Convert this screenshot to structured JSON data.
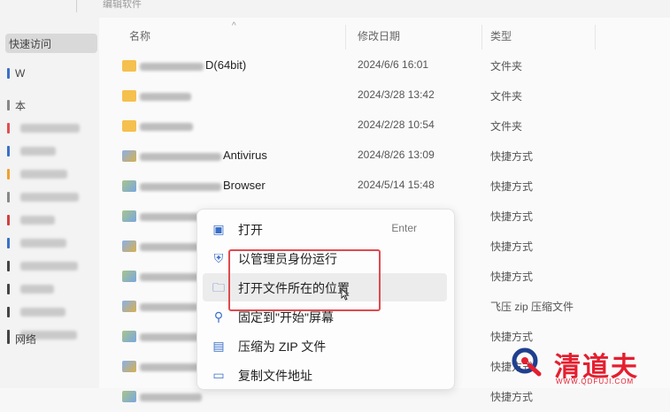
{
  "breadcrumb": "编辑软件",
  "sidebar": {
    "items": [
      {
        "label": "快速访问",
        "selected": true
      },
      {
        "label": "W",
        "color": "#3a6fc8"
      },
      {
        "label": "本",
        "color": "#888888"
      },
      {
        "label": "",
        "color": "#e05050"
      },
      {
        "label": "",
        "color": "#3a6fc8"
      },
      {
        "label": "",
        "color": "#f0a030"
      },
      {
        "label": "",
        "color": "#888888"
      },
      {
        "label": "",
        "color": "#d04040"
      },
      {
        "label": "",
        "color": "#3a6fc8"
      },
      {
        "label": "",
        "color": "#444444"
      },
      {
        "label": "",
        "color": "#444444"
      },
      {
        "label": "",
        "color": "#444444"
      },
      {
        "label": "",
        "color": "#444444"
      },
      {
        "label": "网络",
        "color": "#444444"
      }
    ]
  },
  "columns": {
    "name": "名称",
    "sort_icon": "^",
    "date": "修改日期",
    "type": "类型"
  },
  "rows": [
    {
      "icon": "folder",
      "name": "D(64bit)",
      "date": "2024/6/6 16:01",
      "type": "文件夹"
    },
    {
      "icon": "folder",
      "name": "",
      "date": "2024/3/28 13:42",
      "type": "文件夹"
    },
    {
      "icon": "folder",
      "name": "",
      "date": "2024/2/28 10:54",
      "type": "文件夹"
    },
    {
      "icon": "shortcut",
      "name": "Antivirus",
      "date": "2024/8/26 13:09",
      "type": "快捷方式"
    },
    {
      "icon": "shortcut2",
      "name": "Browser",
      "date": "2024/5/14 15:48",
      "type": "快捷方式"
    },
    {
      "icon": "shortcut2",
      "name": "",
      "date": "",
      "type": "快捷方式"
    },
    {
      "icon": "shortcut",
      "name": "",
      "date": "",
      "type": "快捷方式"
    },
    {
      "icon": "shortcut2",
      "name": "",
      "date": "",
      "type": "快捷方式"
    },
    {
      "icon": "shortcut",
      "name": "",
      "date": "",
      "type": "飞压 zip 压缩文件"
    },
    {
      "icon": "shortcut2",
      "name": "",
      "date": "",
      "type": "快捷方式"
    },
    {
      "icon": "shortcut",
      "name": "",
      "date": "",
      "type": "快捷方式"
    },
    {
      "icon": "shortcut2",
      "name": "",
      "date": "",
      "type": "快捷方式"
    }
  ],
  "context_menu": {
    "items": [
      {
        "label": "打开",
        "hint": "Enter",
        "icon": "open-icon",
        "glyph": "▣"
      },
      {
        "label": "以管理员身份运行",
        "hint": "",
        "icon": "shield-admin-icon",
        "glyph": "⛨"
      },
      {
        "label": "打开文件所在的位置",
        "hint": "",
        "icon": "folder-open-icon",
        "glyph": "🗀"
      },
      {
        "label": "固定到\"开始\"屏幕",
        "hint": "",
        "icon": "pin-icon",
        "glyph": "⚲"
      },
      {
        "label": "压缩为 ZIP 文件",
        "hint": "",
        "icon": "zip-icon",
        "glyph": "▤"
      },
      {
        "label": "复制文件地址",
        "hint": "",
        "icon": "copy-path-icon",
        "glyph": "▭"
      }
    ]
  },
  "logo": {
    "brand": "清道夫",
    "url": "WWW.QDFUJI.COM"
  },
  "colors": {
    "highlight": "#e04a4f",
    "brand": "#e41f2f",
    "folder": "#f5c04e"
  }
}
